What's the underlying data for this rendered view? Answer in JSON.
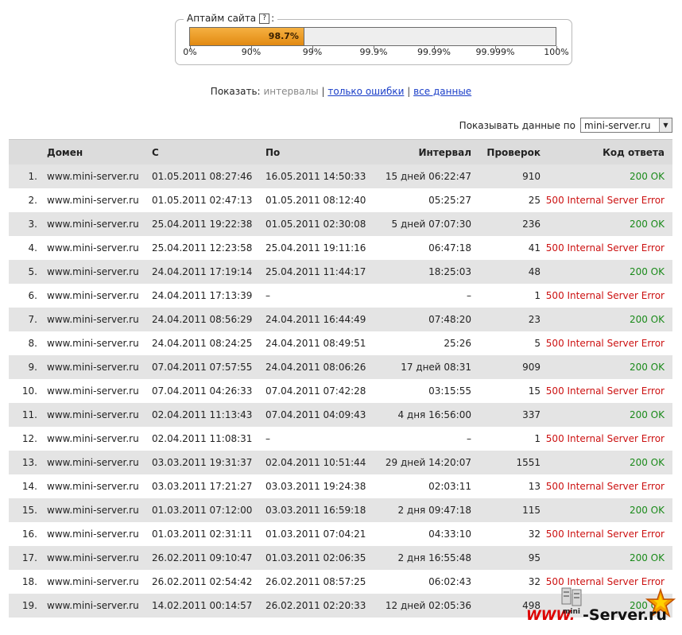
{
  "uptime": {
    "legend": "Аптайм сайта",
    "colon": ":",
    "help": "?",
    "value_label": "98.7%",
    "fill_fraction": 0.313,
    "ticks": [
      "0%",
      "90%",
      "99%",
      "99.9%",
      "99.99%",
      "99.999%",
      "100%"
    ]
  },
  "filter": {
    "prefix": "Показать:",
    "current": "интервалы",
    "sep1": "|",
    "errors_link": "только ошибки",
    "sep2": "|",
    "all_link": "все данные"
  },
  "domain_select": {
    "label": "Показывать данные по",
    "value": "mini-server.ru"
  },
  "table": {
    "headers": [
      "",
      "Домен",
      "С",
      "По",
      "Интервал",
      "Проверок",
      "Код ответа"
    ],
    "rows": [
      [
        "1.",
        "www.mini-server.ru",
        "01.05.2011 08:27:46",
        "16.05.2011 14:50:33",
        "15 дней 06:22:47",
        "910",
        "200 OK"
      ],
      [
        "2.",
        "www.mini-server.ru",
        "01.05.2011 02:47:13",
        "01.05.2011 08:12:40",
        "05:25:27",
        "25",
        "500 Internal Server Error"
      ],
      [
        "3.",
        "www.mini-server.ru",
        "25.04.2011 19:22:38",
        "01.05.2011 02:30:08",
        "5 дней 07:07:30",
        "236",
        "200 OK"
      ],
      [
        "4.",
        "www.mini-server.ru",
        "25.04.2011 12:23:58",
        "25.04.2011 19:11:16",
        "06:47:18",
        "41",
        "500 Internal Server Error"
      ],
      [
        "5.",
        "www.mini-server.ru",
        "24.04.2011 17:19:14",
        "25.04.2011 11:44:17",
        "18:25:03",
        "48",
        "200 OK"
      ],
      [
        "6.",
        "www.mini-server.ru",
        "24.04.2011 17:13:39",
        "–",
        "–",
        "1",
        "500 Internal Server Error"
      ],
      [
        "7.",
        "www.mini-server.ru",
        "24.04.2011 08:56:29",
        "24.04.2011 16:44:49",
        "07:48:20",
        "23",
        "200 OK"
      ],
      [
        "8.",
        "www.mini-server.ru",
        "24.04.2011 08:24:25",
        "24.04.2011 08:49:51",
        "25:26",
        "5",
        "500 Internal Server Error"
      ],
      [
        "9.",
        "www.mini-server.ru",
        "07.04.2011 07:57:55",
        "24.04.2011 08:06:26",
        "17 дней 08:31",
        "909",
        "200 OK"
      ],
      [
        "10.",
        "www.mini-server.ru",
        "07.04.2011 04:26:33",
        "07.04.2011 07:42:28",
        "03:15:55",
        "15",
        "500 Internal Server Error"
      ],
      [
        "11.",
        "www.mini-server.ru",
        "02.04.2011 11:13:43",
        "07.04.2011 04:09:43",
        "4 дня 16:56:00",
        "337",
        "200 OK"
      ],
      [
        "12.",
        "www.mini-server.ru",
        "02.04.2011 11:08:31",
        "–",
        "–",
        "1",
        "500 Internal Server Error"
      ],
      [
        "13.",
        "www.mini-server.ru",
        "03.03.2011 19:31:37",
        "02.04.2011 10:51:44",
        "29 дней 14:20:07",
        "1551",
        "200 OK"
      ],
      [
        "14.",
        "www.mini-server.ru",
        "03.03.2011 17:21:27",
        "03.03.2011 19:24:38",
        "02:03:11",
        "13",
        "500 Internal Server Error"
      ],
      [
        "15.",
        "www.mini-server.ru",
        "01.03.2011 07:12:00",
        "03.03.2011 16:59:18",
        "2 дня 09:47:18",
        "115",
        "200 OK"
      ],
      [
        "16.",
        "www.mini-server.ru",
        "01.03.2011 02:31:11",
        "01.03.2011 07:04:21",
        "04:33:10",
        "32",
        "500 Internal Server Error"
      ],
      [
        "17.",
        "www.mini-server.ru",
        "26.02.2011 09:10:47",
        "01.03.2011 02:06:35",
        "2 дня 16:55:48",
        "95",
        "200 OK"
      ],
      [
        "18.",
        "www.mini-server.ru",
        "26.02.2011 02:54:42",
        "26.02.2011 08:57:25",
        "06:02:43",
        "32",
        "500 Internal Server Error"
      ],
      [
        "19.",
        "www.mini-server.ru",
        "14.02.2011 00:14:57",
        "26.02.2011 02:20:33",
        "12 дней 02:05:36",
        "498",
        "200 OK"
      ]
    ]
  },
  "colors": {
    "ok": "#1a8a1a",
    "error": "#cc1111",
    "bar": "#f0a030",
    "link": "#1a3ec8"
  },
  "logo": {
    "text_www": "WWW.",
    "text_mini": "mini",
    "text_server": "-Server.ru"
  }
}
